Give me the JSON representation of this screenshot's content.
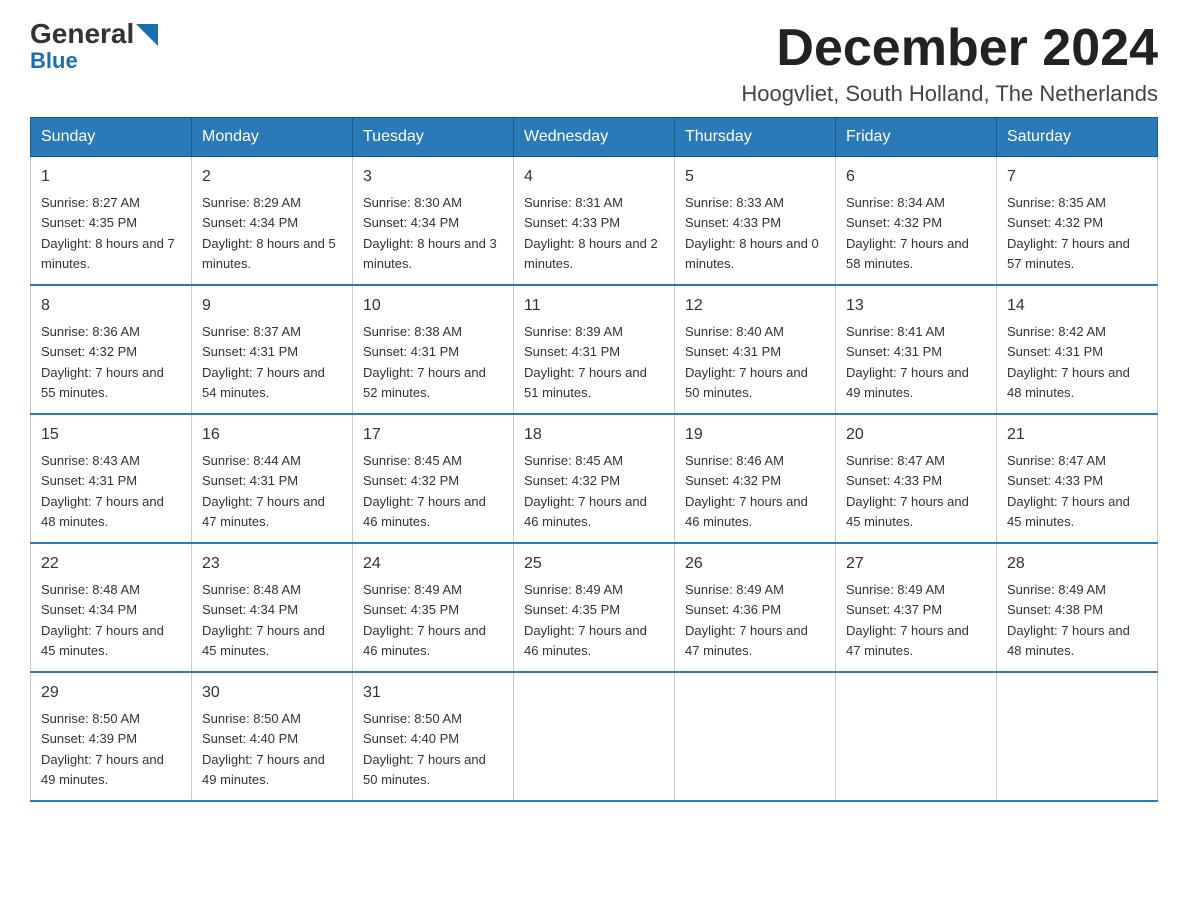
{
  "header": {
    "logo_general": "General",
    "logo_blue": "Blue",
    "month_title": "December 2024",
    "subtitle": "Hoogvliet, South Holland, The Netherlands"
  },
  "weekdays": [
    "Sunday",
    "Monday",
    "Tuesday",
    "Wednesday",
    "Thursday",
    "Friday",
    "Saturday"
  ],
  "weeks": [
    [
      {
        "day": "1",
        "sunrise": "8:27 AM",
        "sunset": "4:35 PM",
        "daylight": "8 hours and 7 minutes."
      },
      {
        "day": "2",
        "sunrise": "8:29 AM",
        "sunset": "4:34 PM",
        "daylight": "8 hours and 5 minutes."
      },
      {
        "day": "3",
        "sunrise": "8:30 AM",
        "sunset": "4:34 PM",
        "daylight": "8 hours and 3 minutes."
      },
      {
        "day": "4",
        "sunrise": "8:31 AM",
        "sunset": "4:33 PM",
        "daylight": "8 hours and 2 minutes."
      },
      {
        "day": "5",
        "sunrise": "8:33 AM",
        "sunset": "4:33 PM",
        "daylight": "8 hours and 0 minutes."
      },
      {
        "day": "6",
        "sunrise": "8:34 AM",
        "sunset": "4:32 PM",
        "daylight": "7 hours and 58 minutes."
      },
      {
        "day": "7",
        "sunrise": "8:35 AM",
        "sunset": "4:32 PM",
        "daylight": "7 hours and 57 minutes."
      }
    ],
    [
      {
        "day": "8",
        "sunrise": "8:36 AM",
        "sunset": "4:32 PM",
        "daylight": "7 hours and 55 minutes."
      },
      {
        "day": "9",
        "sunrise": "8:37 AM",
        "sunset": "4:31 PM",
        "daylight": "7 hours and 54 minutes."
      },
      {
        "day": "10",
        "sunrise": "8:38 AM",
        "sunset": "4:31 PM",
        "daylight": "7 hours and 52 minutes."
      },
      {
        "day": "11",
        "sunrise": "8:39 AM",
        "sunset": "4:31 PM",
        "daylight": "7 hours and 51 minutes."
      },
      {
        "day": "12",
        "sunrise": "8:40 AM",
        "sunset": "4:31 PM",
        "daylight": "7 hours and 50 minutes."
      },
      {
        "day": "13",
        "sunrise": "8:41 AM",
        "sunset": "4:31 PM",
        "daylight": "7 hours and 49 minutes."
      },
      {
        "day": "14",
        "sunrise": "8:42 AM",
        "sunset": "4:31 PM",
        "daylight": "7 hours and 48 minutes."
      }
    ],
    [
      {
        "day": "15",
        "sunrise": "8:43 AM",
        "sunset": "4:31 PM",
        "daylight": "7 hours and 48 minutes."
      },
      {
        "day": "16",
        "sunrise": "8:44 AM",
        "sunset": "4:31 PM",
        "daylight": "7 hours and 47 minutes."
      },
      {
        "day": "17",
        "sunrise": "8:45 AM",
        "sunset": "4:32 PM",
        "daylight": "7 hours and 46 minutes."
      },
      {
        "day": "18",
        "sunrise": "8:45 AM",
        "sunset": "4:32 PM",
        "daylight": "7 hours and 46 minutes."
      },
      {
        "day": "19",
        "sunrise": "8:46 AM",
        "sunset": "4:32 PM",
        "daylight": "7 hours and 46 minutes."
      },
      {
        "day": "20",
        "sunrise": "8:47 AM",
        "sunset": "4:33 PM",
        "daylight": "7 hours and 45 minutes."
      },
      {
        "day": "21",
        "sunrise": "8:47 AM",
        "sunset": "4:33 PM",
        "daylight": "7 hours and 45 minutes."
      }
    ],
    [
      {
        "day": "22",
        "sunrise": "8:48 AM",
        "sunset": "4:34 PM",
        "daylight": "7 hours and 45 minutes."
      },
      {
        "day": "23",
        "sunrise": "8:48 AM",
        "sunset": "4:34 PM",
        "daylight": "7 hours and 45 minutes."
      },
      {
        "day": "24",
        "sunrise": "8:49 AM",
        "sunset": "4:35 PM",
        "daylight": "7 hours and 46 minutes."
      },
      {
        "day": "25",
        "sunrise": "8:49 AM",
        "sunset": "4:35 PM",
        "daylight": "7 hours and 46 minutes."
      },
      {
        "day": "26",
        "sunrise": "8:49 AM",
        "sunset": "4:36 PM",
        "daylight": "7 hours and 47 minutes."
      },
      {
        "day": "27",
        "sunrise": "8:49 AM",
        "sunset": "4:37 PM",
        "daylight": "7 hours and 47 minutes."
      },
      {
        "day": "28",
        "sunrise": "8:49 AM",
        "sunset": "4:38 PM",
        "daylight": "7 hours and 48 minutes."
      }
    ],
    [
      {
        "day": "29",
        "sunrise": "8:50 AM",
        "sunset": "4:39 PM",
        "daylight": "7 hours and 49 minutes."
      },
      {
        "day": "30",
        "sunrise": "8:50 AM",
        "sunset": "4:40 PM",
        "daylight": "7 hours and 49 minutes."
      },
      {
        "day": "31",
        "sunrise": "8:50 AM",
        "sunset": "4:40 PM",
        "daylight": "7 hours and 50 minutes."
      },
      null,
      null,
      null,
      null
    ]
  ]
}
